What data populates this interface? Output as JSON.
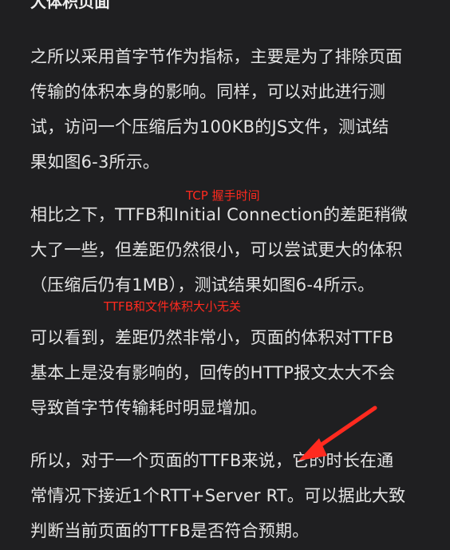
{
  "heading": "大体积页面",
  "paragraphs": [
    {
      "lines": [
        "之所以采用首字节作为指标，主要是为了排除页面",
        "传输的体积本身的影响。同样，可以对此进行测",
        "试，访问一个压缩后为100KB的JS文件，测试结",
        "果如图6-3所示。"
      ]
    },
    {
      "lines": [
        "相比之下，TTFB和Initial Connection的差距稍微",
        "大了一些，但差距仍然很小，可以尝试更大的体积",
        "（压缩后仍有1MB），测试结果如图6-4所示。"
      ]
    },
    {
      "lines": [
        "可以看到，差距仍然非常小，页面的体积对TTFB",
        "基本上是没有影响的，回传的HTTP报文太大不会",
        "导致首字节传输耗时明显增加。"
      ]
    },
    {
      "lines": [
        "所以，对于一个页面的TTFB来说，它的时长在通",
        "常情况下接近1个RTT+Server RT。可以据此大致",
        "判断当前页面的TTFB是否符合预期。"
      ]
    }
  ],
  "annotations": {
    "tcp_handshake": "TCP 握手时间",
    "ttfb_size": "TTFB和文件体积大小无关"
  },
  "colors": {
    "background": "#1f1f21",
    "text": "#e4e4e4",
    "annotation": "#ff2a1f"
  }
}
